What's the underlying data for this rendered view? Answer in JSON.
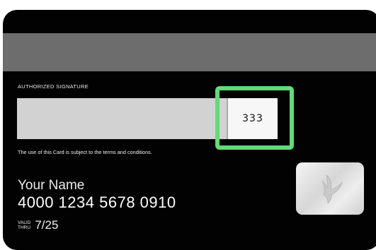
{
  "card": {
    "signature_label": "AUTHORIZED SIGNATURE",
    "cvv": "333",
    "terms": "The use of this Card is subject to the terms and conditions.",
    "holder_name": "Your Name",
    "card_number": "4000 1234 5678 0910",
    "valid_label_line1": "VALID",
    "valid_label_line2": "THRU",
    "expiry": "7/25",
    "hologram_icon": "bird-hologram-icon"
  },
  "colors": {
    "card_background": "#020202",
    "magnetic_stripe": "#6d6d6d",
    "signature_strip": "#d2d2d2",
    "cvv_highlight": "#65d97a"
  }
}
